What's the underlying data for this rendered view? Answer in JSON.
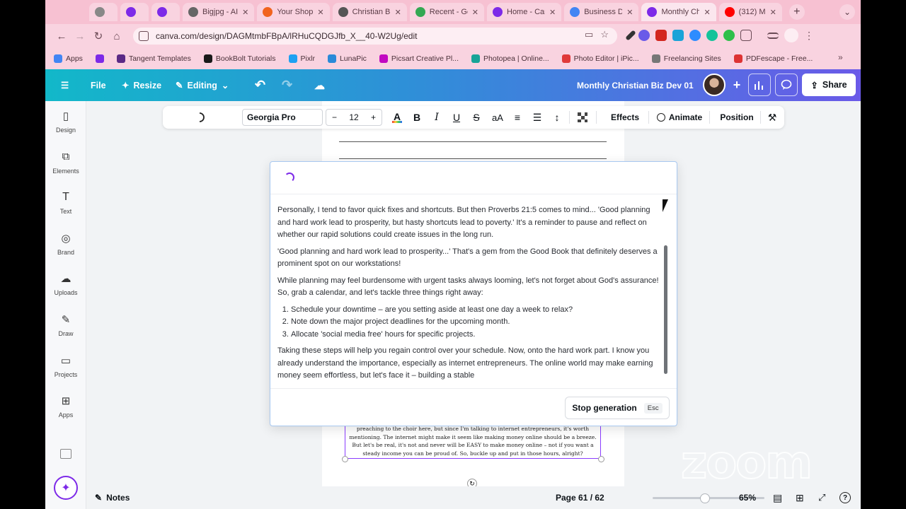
{
  "browser": {
    "tabs": [
      {
        "label": "",
        "icon": "pdf-icon",
        "color": "#888"
      },
      {
        "label": "",
        "icon": "canva-icon",
        "color": "#7d2ae8"
      },
      {
        "label": "",
        "icon": "canva-icon",
        "color": "#7d2ae8"
      },
      {
        "label": "Bigjpg - AI",
        "icon": "b-icon",
        "color": "#666"
      },
      {
        "label": "Your Shop",
        "icon": "etsy-icon",
        "color": "#f1641e"
      },
      {
        "label": "Christian Bi",
        "icon": "globe-icon",
        "color": "#555"
      },
      {
        "label": "Recent - Gc",
        "icon": "drive-icon",
        "color": "#34a853"
      },
      {
        "label": "Home - Can",
        "icon": "canva-icon",
        "color": "#7d2ae8"
      },
      {
        "label": "Business Di",
        "icon": "docs-icon",
        "color": "#4285f4"
      },
      {
        "label": "Monthly Chr",
        "icon": "canva-icon",
        "color": "#7d2ae8",
        "active": true
      },
      {
        "label": "(312) M",
        "icon": "youtube-icon",
        "color": "#ff0000"
      }
    ],
    "url": "canva.com/design/DAGMtmbFBpA/lRHuCQDGJfb_X__40-W2Ug/edit",
    "bookmarks": [
      {
        "label": "Apps",
        "color": "#4285f4"
      },
      {
        "label": "",
        "color": "#7d2ae8"
      },
      {
        "label": "Tangent Templates",
        "color": "#5b2a86"
      },
      {
        "label": "BookBolt Tutorials",
        "color": "#1a1a1a"
      },
      {
        "label": "Pixlr",
        "color": "#1da1f2"
      },
      {
        "label": "LunaPic",
        "color": "#2b8ad8"
      },
      {
        "label": "Picsart Creative Pl...",
        "color": "#c209c1"
      },
      {
        "label": "Photopea | Online...",
        "color": "#18a497"
      },
      {
        "label": "Photo Editor | iPic...",
        "color": "#e03a3a"
      },
      {
        "label": "Freelancing Sites",
        "color": "#777"
      },
      {
        "label": "PDFescape - Free...",
        "color": "#d33"
      }
    ]
  },
  "header": {
    "file": "File",
    "resize": "Resize",
    "editing": "Editing",
    "title": "Monthly Christian Biz Dev 01",
    "share": "Share"
  },
  "rail": [
    {
      "label": "Design",
      "icon": "design-icon"
    },
    {
      "label": "Elements",
      "icon": "elements-icon"
    },
    {
      "label": "Text",
      "icon": "text-icon"
    },
    {
      "label": "Brand",
      "icon": "brand-icon"
    },
    {
      "label": "Uploads",
      "icon": "uploads-icon"
    },
    {
      "label": "Draw",
      "icon": "draw-icon"
    },
    {
      "label": "Projects",
      "icon": "projects-icon"
    },
    {
      "label": "Apps",
      "icon": "apps-icon"
    }
  ],
  "toolbar": {
    "font": "Georgia Pro",
    "size": "12",
    "effects": "Effects",
    "animate": "Animate",
    "position": "Position"
  },
  "dialog": {
    "p1": "Personally, I tend to favor quick fixes and shortcuts. But then Proverbs 21:5 comes to mind... 'Good planning and hard work lead to prosperity, but hasty shortcuts lead to poverty.' It's a reminder to pause and reflect on whether our rapid solutions could create issues in the long run.",
    "p2": "'Good planning and hard work lead to prosperity...' That's a gem from the Good Book that definitely deserves a prominent spot on our workstations!",
    "p3": "While planning may feel burdensome with urgent tasks always looming, let's not forget about God's assurance! So, grab a calendar, and let's tackle three things right away:",
    "list": [
      "Schedule your downtime – are you setting aside at least one day a week to relax?",
      "Note down the major project deadlines for the upcoming month.",
      "Allocate 'social media free' hours for specific projects."
    ],
    "p4": "Taking these steps will help you regain control over your schedule. Now, onto the hard work part. I know you already understand the importance, especially as internet entrepreneurs. The online world may make earning money seem effortless, but let's face it – building a stable",
    "stop": "Stop generation",
    "esc": "Esc"
  },
  "page_text": "preaching to the choir here, but since I'm talking to internet entrepreneurs, it's worth mentioning. The internet might make it seem like making money online should be a breeze. But let's be real, it's not and never will be EASY to make money online – not if you want a steady income you can be proud of. So, buckle up and put in those hours, alright?",
  "bottom": {
    "notes": "Notes",
    "page": "Page 61 / 62",
    "zoom": "65%",
    "zoom_fraction": 0.47
  },
  "watermark": "zoom"
}
